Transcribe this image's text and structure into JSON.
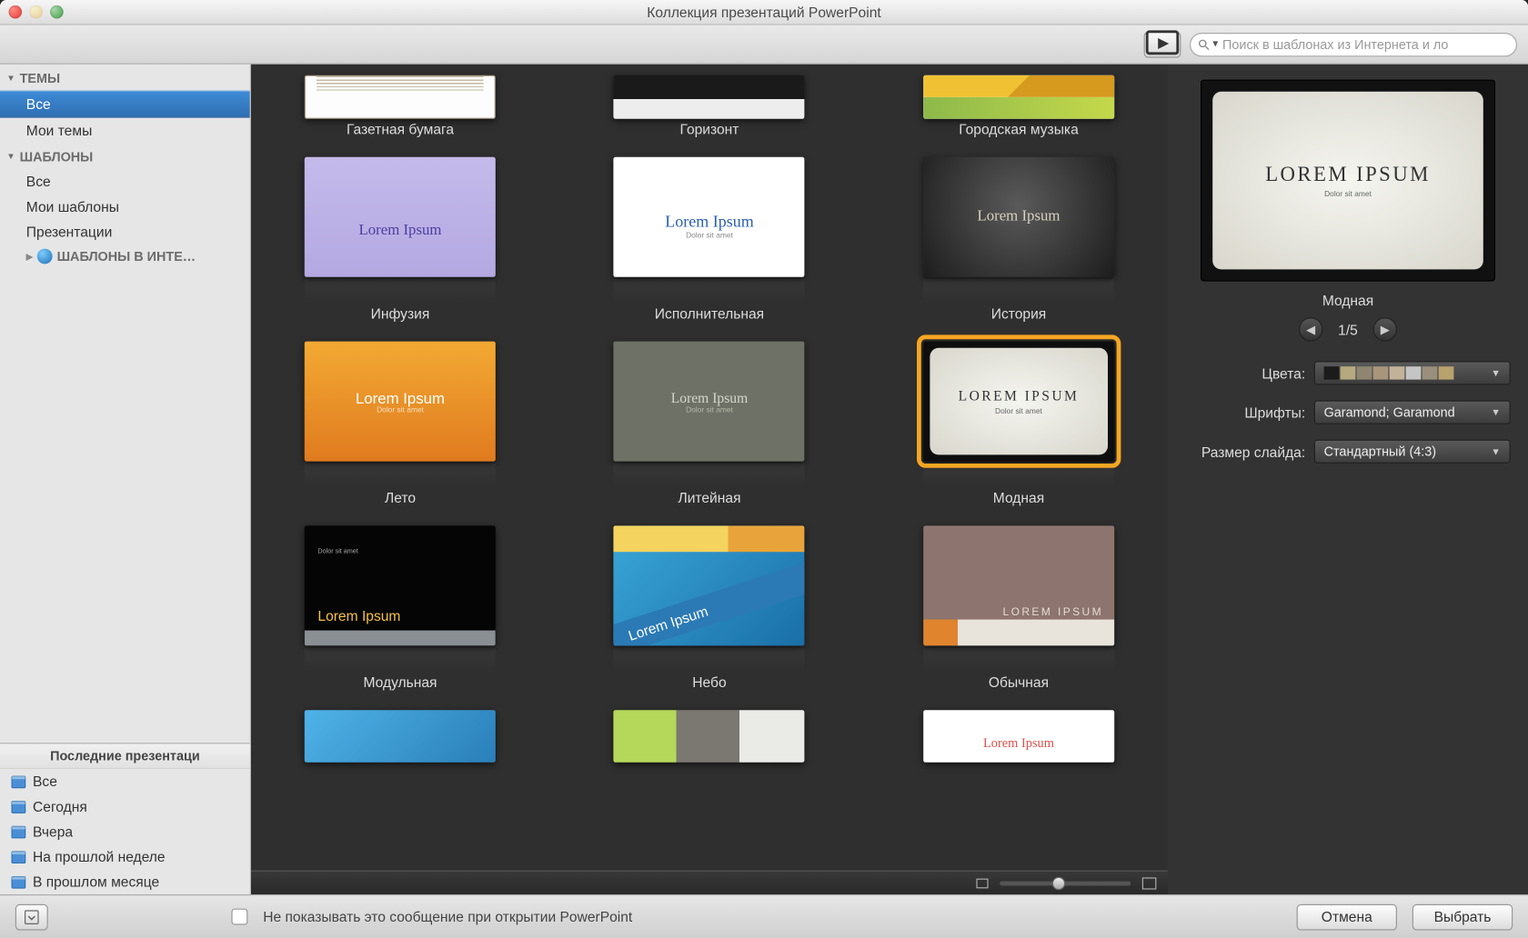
{
  "window_title": "Коллекция презентаций PowerPoint",
  "search_placeholder": "Поиск в шаблонах из Интернета и ло",
  "sidebar": {
    "sections": {
      "themes": {
        "header": "ТЕМЫ",
        "all": "Все",
        "my": "Мои темы"
      },
      "templates": {
        "header": "ШАБЛОНЫ",
        "all": "Все",
        "my": "Мои шаблоны",
        "pres": "Презентации"
      },
      "online": "ШАБЛОНЫ В ИНТЕ…"
    },
    "recent": {
      "header": "Последние презентаци",
      "items": [
        "Все",
        "Сегодня",
        "Вчера",
        "На прошлой неделе",
        "В прошлом месяце"
      ]
    }
  },
  "templates": {
    "row0": [
      "Газетная бумага",
      "Горизонт",
      "Городская музыка"
    ],
    "row1": [
      "Инфузия",
      "Исполнительная",
      "История"
    ],
    "row2": [
      "Лето",
      "Литейная",
      "Модная"
    ],
    "row3": [
      "Модульная",
      "Небо",
      "Обычная"
    ],
    "lorem": "Lorem Ipsum",
    "lorem_upper": "LOREM IPSUM",
    "lorem_sub": "Dolor sit amet"
  },
  "preview": {
    "name": "Модная",
    "page": "1/5",
    "big": "LOREM IPSUM",
    "sub": "Dolor sit amet",
    "labels": {
      "colors": "Цвета:",
      "fonts": "Шрифты:",
      "size": "Размер слайда:"
    },
    "fonts_value": "Garamond; Garamond",
    "size_value": "Стандартный (4:3)",
    "swatches": [
      "#1b1b1b",
      "#b6a97f",
      "#8f8672",
      "#a8967c",
      "#c2b299",
      "#c5c5c5",
      "#9a8f7a",
      "#b8a26e"
    ]
  },
  "footer": {
    "checkbox_label": "Не показывать это сообщение при открытии PowerPoint",
    "cancel": "Отмена",
    "choose": "Выбрать"
  }
}
